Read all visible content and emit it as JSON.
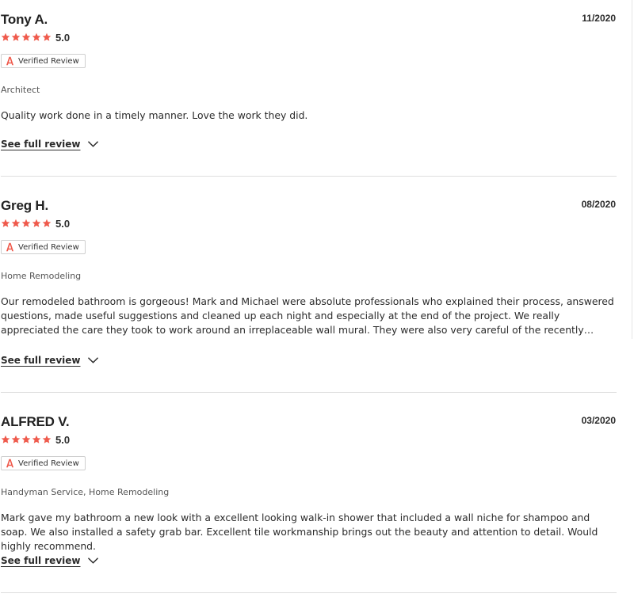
{
  "colors": {
    "star": "#ef5a4c",
    "badge_icon": "#ef5a4c",
    "divider": "#dedede",
    "text": "#2b2b2b"
  },
  "icons": {
    "star": "star-icon",
    "verified": "angi-logo-icon",
    "expand": "chevron-down-icon"
  },
  "reviews": [
    {
      "name": "Tony A.",
      "date": "11/2020",
      "rating": 5,
      "rating_label": "5.0",
      "verified_label": "Verified Review",
      "category": "Architect",
      "text": "Quality work done in a timely manner. Love the work they did.",
      "link_label": "See full review"
    },
    {
      "name": "Greg H.",
      "date": "08/2020",
      "rating": 5,
      "rating_label": "5.0",
      "verified_label": "Verified Review",
      "category": "Home Remodeling",
      "text": "Our remodeled bathroom is gorgeous! Mark and Michael were absolute professionals who explained their process, answered questions, made useful suggestions and cleaned up each night and especially at the end of the project. We really appreciated the care they took to work around an irreplaceable wall mural. They were also very careful of the recently painted walls and did some…",
      "link_label": "See full review"
    },
    {
      "name": "ALFRED V.",
      "date": "03/2020",
      "rating": 5,
      "rating_label": "5.0",
      "verified_label": "Verified Review",
      "category": "Handyman Service, Home Remodeling",
      "text": "Mark gave my bathroom a new look with a excellent looking walk-in shower that included a wall niche for shampoo and soap. We also installed a safety grab bar. Excellent tile workmanship brings out the beauty and attention to detail. Would highly recommend.",
      "link_label": "See full review"
    }
  ]
}
